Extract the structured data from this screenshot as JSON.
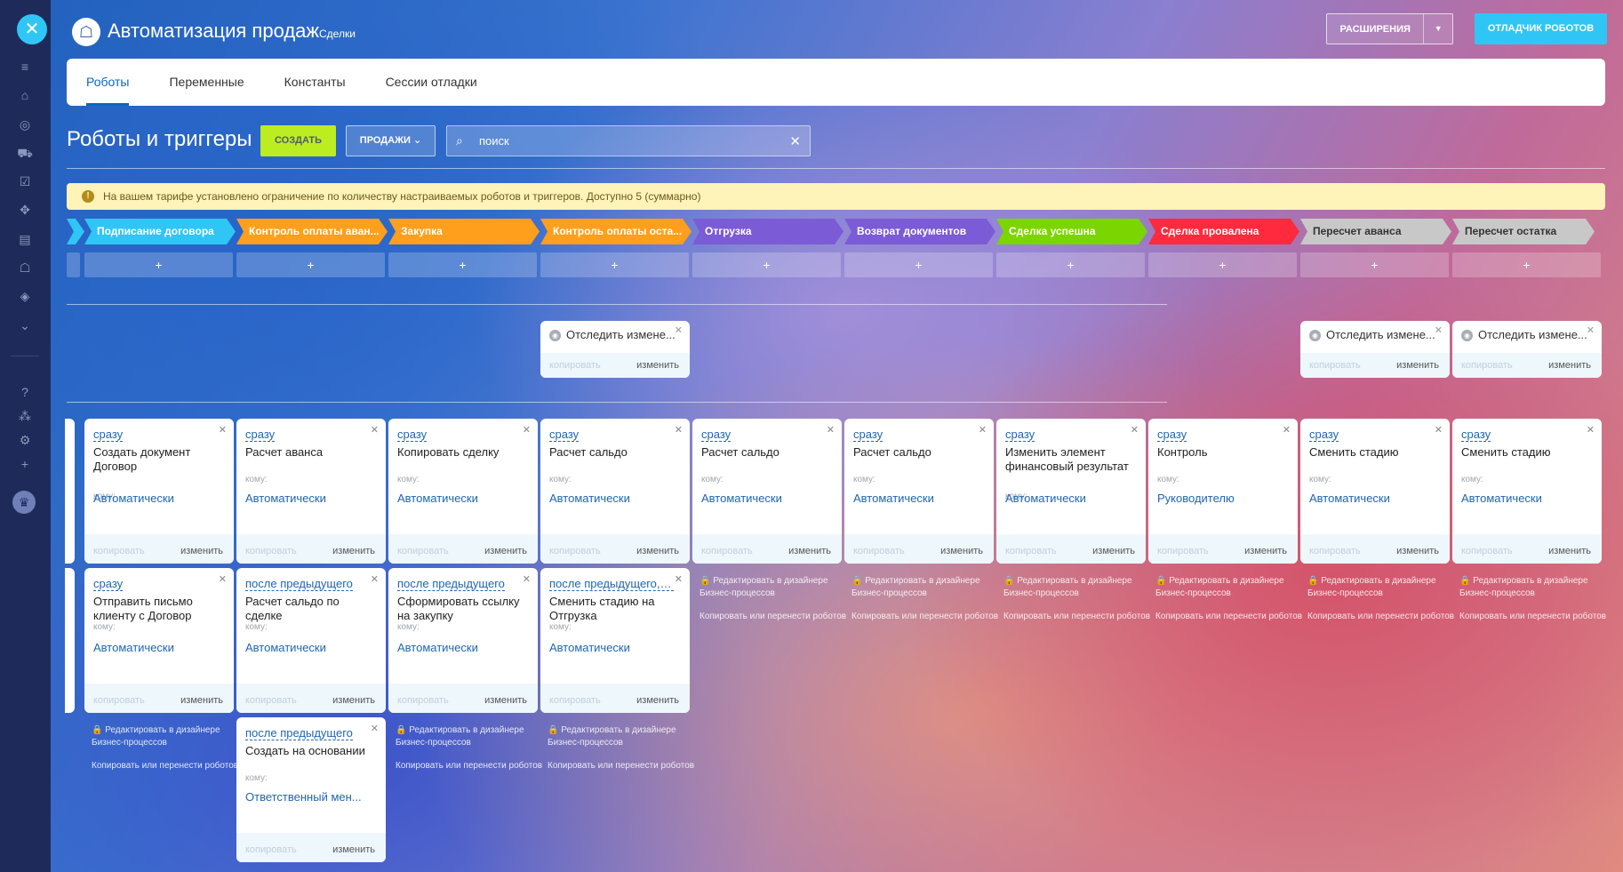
{
  "app": {
    "title": "Автоматизация продаж",
    "subtitle": "Сделки",
    "extensions_label": "РАСШИРЕНИЯ",
    "debugger_label": "ОТЛАДЧИК РОБОТОВ",
    "logo_icon": "robot-icon"
  },
  "tabs": [
    {
      "label": "Роботы",
      "active": true
    },
    {
      "label": "Переменные"
    },
    {
      "label": "Константы"
    },
    {
      "label": "Сессии отладки"
    }
  ],
  "toolbar": {
    "title": "Роботы и триггеры",
    "create_label": "СОЗДАТЬ",
    "pipeline_label": "ПРОДАЖИ",
    "search_placeholder": "поиск"
  },
  "alert": {
    "text": "На вашем тарифе установлено ограничение по количеству настраиваемых роботов и триггеров. Доступно 5 (суммарно)",
    "icon": "exclamation-icon"
  },
  "stages": [
    {
      "label": "Подписание договора",
      "color": "#2fc6f6"
    },
    {
      "label": "Контроль оплаты аван...",
      "color": "#ff9f1c"
    },
    {
      "label": "Закупка",
      "color": "#ff9f1c"
    },
    {
      "label": "Контроль оплаты оста...",
      "color": "#ff9f1c"
    },
    {
      "label": "Отгрузка",
      "color": "#7b5bd6"
    },
    {
      "label": "Возврат документов",
      "color": "#7b5bd6"
    },
    {
      "label": "Сделка успешна",
      "color": "#7bd500"
    },
    {
      "label": "Сделка провалена",
      "color": "#ff2a3d"
    },
    {
      "label": "Пересчет аванса",
      "color": "#c8c8c8"
    },
    {
      "label": "Пересчет остатка",
      "color": "#c8c8c8"
    }
  ],
  "add_label": "+",
  "common": {
    "copy": "копировать",
    "edit": "изменить",
    "to": "кому:",
    "edit_in_designer": "Редактировать в дизайнере Бизнес-процессов",
    "copy_or_move": "Копировать или перенести роботов"
  },
  "triggers": [
    {
      "title": "Отследить измене..."
    },
    {
      "title": "Отследить измене..."
    },
    {
      "title": "Отследить измене..."
    }
  ],
  "robots_row1": [
    {
      "when": "сразу",
      "title": "Создать документ Договор",
      "who": "Автоматически"
    },
    {
      "when": "сразу",
      "title": "Расчет аванса",
      "who": "Автоматически"
    },
    {
      "when": "сразу",
      "title": "Копировать сделку",
      "who": "Автоматически"
    },
    {
      "when": "сразу",
      "title": "Расчет сальдо",
      "who": "Автоматически"
    },
    {
      "when": "сразу",
      "title": "Расчет сальдо",
      "who": "Автоматически"
    },
    {
      "when": "сразу",
      "title": "Расчет сальдо",
      "who": "Автоматически"
    },
    {
      "when": "сразу",
      "title": "Изменить элемент финансовый результат",
      "who": "Автоматически"
    },
    {
      "when": "сразу",
      "title": "Контроль",
      "who": "Руководителю"
    },
    {
      "when": "сразу",
      "title": "Сменить стадию",
      "who": "Автоматически"
    },
    {
      "when": "сразу",
      "title": "Сменить стадию",
      "who": "Автоматически"
    }
  ],
  "robots_row2": [
    {
      "when": "сразу",
      "title": "Отправить письмо клиенту с Договор",
      "who": "Автоматически"
    },
    {
      "when": "после предыдущего",
      "title": "Расчет сальдо по сделке",
      "who": "Автоматически"
    },
    {
      "when": "после предыдущего",
      "title": "Сформировать ссылку на закупку",
      "who": "Автоматически"
    },
    {
      "when": "после предыдущего, п...",
      "title": "Сменить стадию на Отгрузка",
      "who": "Автоматически"
    }
  ],
  "robots_row3": [
    {
      "when": "после предыдущего",
      "title": "Создать на основании",
      "who": "Ответственный мен..."
    }
  ]
}
